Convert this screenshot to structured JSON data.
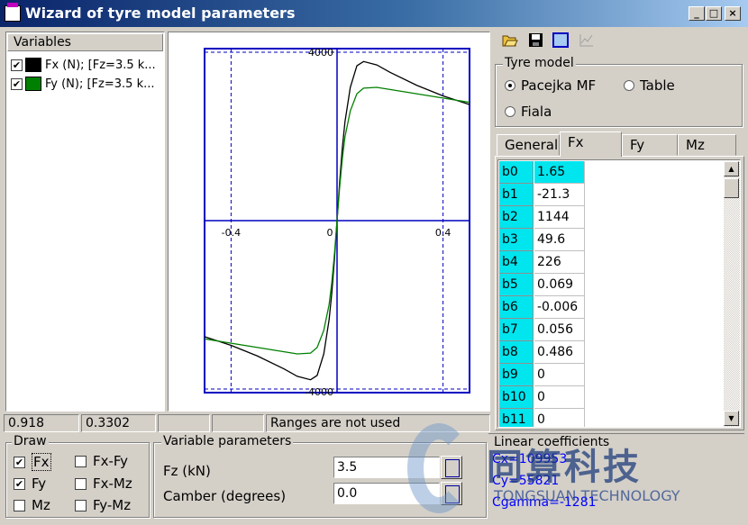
{
  "window": {
    "title": "Wizard of tyre model parameters",
    "buttons": [
      "_",
      "□",
      "×"
    ]
  },
  "variables": {
    "header": "Variables",
    "items": [
      {
        "checked": true,
        "color": "#000000",
        "label": "Fx (N);  [Fz=3.5 k..."
      },
      {
        "checked": true,
        "color": "#008000",
        "label": "Fy (N);  [Fz=3.5 k..."
      }
    ]
  },
  "chart_data": {
    "type": "line",
    "title": "",
    "xlabel": "",
    "ylabel": "",
    "xlim": [
      -0.5,
      0.5
    ],
    "ylim": [
      -4000,
      4000
    ],
    "x_ticks": [
      "-0.4",
      "0",
      "0.4"
    ],
    "y_ticks": [
      "4000",
      "-4000"
    ],
    "grid": false,
    "series": [
      {
        "color": "#000000",
        "x": [
          -0.5,
          -0.4,
          -0.3,
          -0.2,
          -0.15,
          -0.1,
          -0.075,
          -0.05,
          -0.03,
          -0.02,
          -0.01,
          0,
          0.01,
          0.02,
          0.03,
          0.05,
          0.075,
          0.1,
          0.15,
          0.2,
          0.3,
          0.4,
          0.5
        ],
        "y": [
          -2700,
          -2900,
          -3150,
          -3450,
          -3620,
          -3700,
          -3600,
          -3100,
          -2300,
          -1700,
          -900,
          0,
          900,
          1700,
          2300,
          3100,
          3600,
          3700,
          3620,
          3450,
          3150,
          2900,
          2700
        ]
      },
      {
        "color": "#008000",
        "x": [
          -0.5,
          -0.4,
          -0.3,
          -0.2,
          -0.15,
          -0.1,
          -0.075,
          -0.05,
          -0.03,
          -0.02,
          -0.01,
          0,
          0.01,
          0.02,
          0.03,
          0.05,
          0.075,
          0.1,
          0.15,
          0.2,
          0.3,
          0.4,
          0.5
        ],
        "y": [
          -2750,
          -2850,
          -2950,
          -3050,
          -3100,
          -3080,
          -2950,
          -2550,
          -1950,
          -1450,
          -780,
          0,
          780,
          1450,
          1950,
          2550,
          2950,
          3080,
          3100,
          3050,
          2950,
          2850,
          2750
        ]
      }
    ]
  },
  "status": {
    "cells": [
      "0.918",
      "0.3302",
      "",
      "",
      "Ranges are not used"
    ]
  },
  "toolbar": {
    "icons": [
      "folder-open-icon",
      "save-icon",
      "window-icon",
      "chart-icon"
    ]
  },
  "tyre_model": {
    "label": "Tyre model",
    "options": [
      {
        "label": "Pacejka MF",
        "selected": true
      },
      {
        "label": "Table",
        "selected": false
      },
      {
        "label": "Fiala",
        "selected": false
      }
    ]
  },
  "tabs": [
    {
      "label": "General",
      "active": false
    },
    {
      "label": "Fx",
      "active": true
    },
    {
      "label": "Fy",
      "active": false
    },
    {
      "label": "Mz",
      "active": false
    }
  ],
  "params": [
    {
      "name": "b0",
      "value": "1.65"
    },
    {
      "name": "b1",
      "value": "-21.3"
    },
    {
      "name": "b2",
      "value": "1144"
    },
    {
      "name": "b3",
      "value": "49.6"
    },
    {
      "name": "b4",
      "value": "226"
    },
    {
      "name": "b5",
      "value": "0.069"
    },
    {
      "name": "b6",
      "value": "-0.006"
    },
    {
      "name": "b7",
      "value": "0.056"
    },
    {
      "name": "b8",
      "value": "0.486"
    },
    {
      "name": "b9",
      "value": "0"
    },
    {
      "name": "b10",
      "value": "0"
    },
    {
      "name": "b11",
      "value": "0"
    }
  ],
  "draw": {
    "label": "Draw",
    "options": [
      {
        "label": "Fx",
        "checked": true
      },
      {
        "label": "Fx-Fy",
        "checked": false
      },
      {
        "label": "Fy",
        "checked": true
      },
      {
        "label": "Fx-Mz",
        "checked": false
      },
      {
        "label": "Mz",
        "checked": false
      },
      {
        "label": "Fy-Mz",
        "checked": false
      }
    ]
  },
  "variable_params": {
    "label": "Variable parameters",
    "fz_label": "Fz (kN)",
    "fz_value": "3.5",
    "camber_label": "Camber (degrees)",
    "camber_value": "0.0"
  },
  "linear": {
    "label": "Linear coefficients",
    "cx": "Cx=109953",
    "cy": "Cy=55821",
    "cgamma": "Cgamma=-1281"
  },
  "watermark": {
    "cn": "同算科技",
    "en": "TONGSUAN TECHNOLOGY"
  }
}
